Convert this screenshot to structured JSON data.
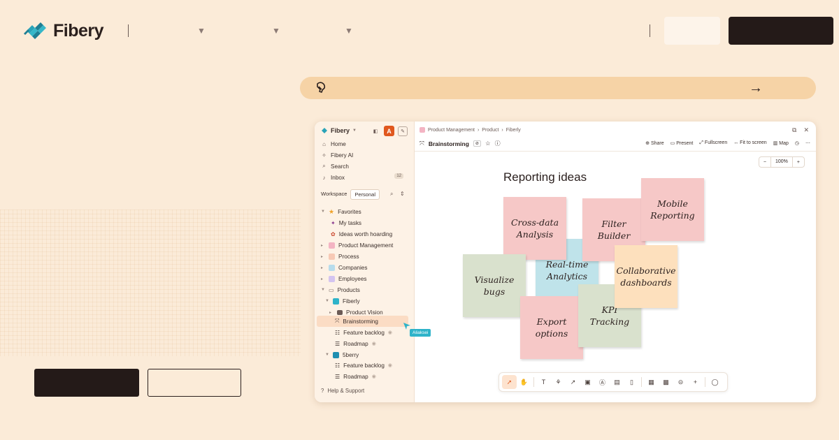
{
  "brand": {
    "name": "Fibery"
  },
  "banner": {
    "arrow": "→"
  },
  "app": {
    "sidebar": {
      "workspace_name": "Fibery",
      "avatar_letter": "A",
      "nav": [
        {
          "label": "Home",
          "icon": "home-icon",
          "glyph": "⌂"
        },
        {
          "label": "Fibery AI",
          "icon": "sparkle-icon",
          "glyph": "✧"
        },
        {
          "label": "Search",
          "icon": "search-icon",
          "glyph": "⌕"
        },
        {
          "label": "Inbox",
          "icon": "bell-icon",
          "glyph": "🔔",
          "count": "12"
        }
      ],
      "segments": {
        "workspace": "Workspace",
        "personal": "Personal"
      },
      "tree": {
        "favorites": "Favorites",
        "my_tasks": "My tasks",
        "ideas": "Ideas worth hoarding",
        "product_management": "Product Management",
        "process": "Process",
        "companies": "Companies",
        "employees": "Employees",
        "products": "Products",
        "fiberly": "Fiberly",
        "product_vision": "Product Vision",
        "brainstorming": "Brainstorming",
        "feature_backlog": "Feature backlog",
        "roadmap": "Roadmap",
        "fiveberry": "5berry",
        "feature_backlog_2": "Feature backlog",
        "roadmap_2": "Roadmap"
      },
      "cursor_user": "Aliaksei",
      "help": "Help & Support"
    },
    "breadcrumbs": [
      "Product Management",
      "Product",
      "Fiberly"
    ],
    "view_title": "Brainstorming",
    "toolbar": {
      "share": "Share",
      "present": "Present",
      "fullscreen": "Fullscreen",
      "fit": "Fit to screen",
      "map": "Map"
    },
    "zoom": {
      "minus": "−",
      "value": "100%",
      "plus": "+"
    },
    "board": {
      "title": "Reporting ideas",
      "notes": {
        "cross_data": "Cross-data Analysis",
        "filter_builder": "Filter Builder",
        "mobile": "Mobile Reporting",
        "realtime": "Real-time Analytics",
        "collab": "Collaborative dashboards",
        "visualize": "Visualize bugs",
        "export": "Export options",
        "kpi": "KPI Tracking"
      }
    }
  },
  "colors": {
    "background": "#fbebd8",
    "dark": "#241a18",
    "banner": "#f6d3a6",
    "accent": "#e0581e",
    "note_pink": "#f6c8c7",
    "note_blue": "#bfe3ea",
    "note_green": "#d9e1cd",
    "note_peach": "#fde0bd"
  }
}
